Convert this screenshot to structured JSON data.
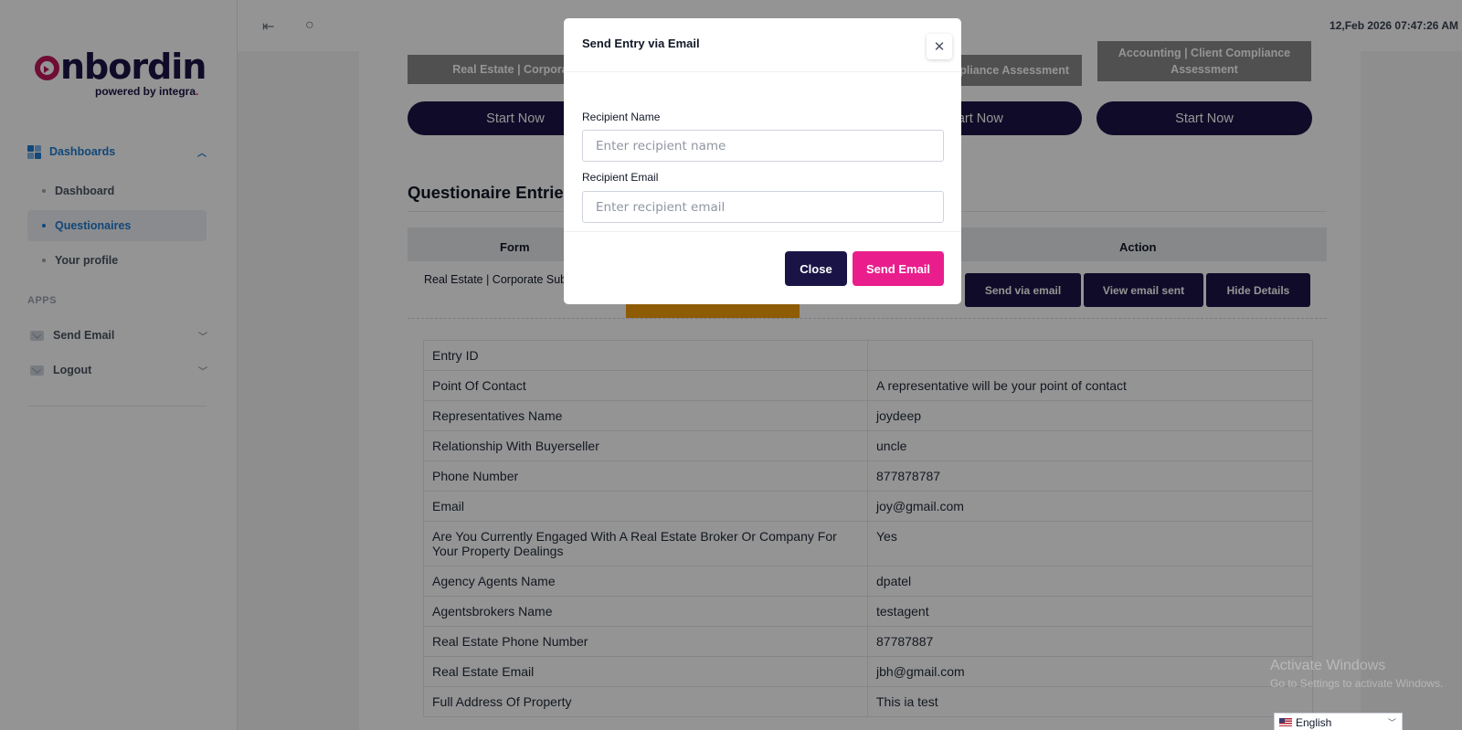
{
  "topbar": {
    "collapse_icon": "collapse-left-icon",
    "search_icon": "search-icon",
    "datetime": "12,Feb 2026 07:47:26 AM"
  },
  "brand": {
    "logo_text": "nbordin",
    "tagline": "powered by integra",
    "tagline_dot": "."
  },
  "sidebar": {
    "group_label": "Dashboards",
    "items": [
      {
        "label": "Dashboard"
      },
      {
        "label": "Questionaires"
      },
      {
        "label": "Your profile"
      }
    ],
    "apps_label": "APPS",
    "apps": [
      {
        "label": "Send Email"
      },
      {
        "label": "Logout"
      }
    ]
  },
  "cards": [
    {
      "title": "Real Estate | Corporate",
      "button": "Start Now"
    },
    {
      "title": "Compliance Assessment",
      "button": "Start Now"
    },
    {
      "title_line1": "Accounting | Client Compliance",
      "title_line2": "Assessment",
      "button": "Start Now"
    }
  ],
  "entries": {
    "title": "Questionaire Entries",
    "headers": {
      "form": "Form",
      "action": "Action"
    },
    "row": {
      "form": "Real Estate | Corporate Sub",
      "actions": [
        "Send via email",
        "View email sent",
        "Hide Details"
      ]
    },
    "details": [
      {
        "key": "Entry ID",
        "value": ""
      },
      {
        "key": "Point Of Contact",
        "value": "A representative will be your point of contact"
      },
      {
        "key": "Representatives Name",
        "value": "joydeep"
      },
      {
        "key": "Relationship With Buyerseller",
        "value": "uncle"
      },
      {
        "key": "Phone Number",
        "value": "877878787"
      },
      {
        "key": "Email",
        "value": "joy@gmail.com"
      },
      {
        "key": "Are You Currently Engaged With A Real Estate Broker Or Company For Your Property Dealings",
        "value": "Yes"
      },
      {
        "key": "Agency Agents Name",
        "value": "dpatel"
      },
      {
        "key": "Agentsbrokers Name",
        "value": "testagent"
      },
      {
        "key": "Real Estate Phone Number",
        "value": "87787887"
      },
      {
        "key": "Real Estate Email",
        "value": "jbh@gmail.com"
      },
      {
        "key": "Full Address Of Property",
        "value": "This ia test"
      }
    ]
  },
  "modal": {
    "title": "Send Entry via Email",
    "close_icon": "close-icon",
    "name_label": "Recipient Name",
    "name_placeholder": "Enter recipient name",
    "name_value": "",
    "email_label": "Recipient Email",
    "email_placeholder": "Enter recipient email",
    "email_value": "",
    "close_button": "Close",
    "send_button": "Send Email"
  },
  "colors": {
    "primary_navy": "#1a1446",
    "accent_pink": "#e91e8c",
    "nav_blue": "#1e7bd1",
    "orange": "#f59e0b"
  },
  "watermark": {
    "line1": "Activate Windows",
    "line2": "Go to Settings to activate Windows."
  },
  "language": {
    "selected": "English"
  }
}
